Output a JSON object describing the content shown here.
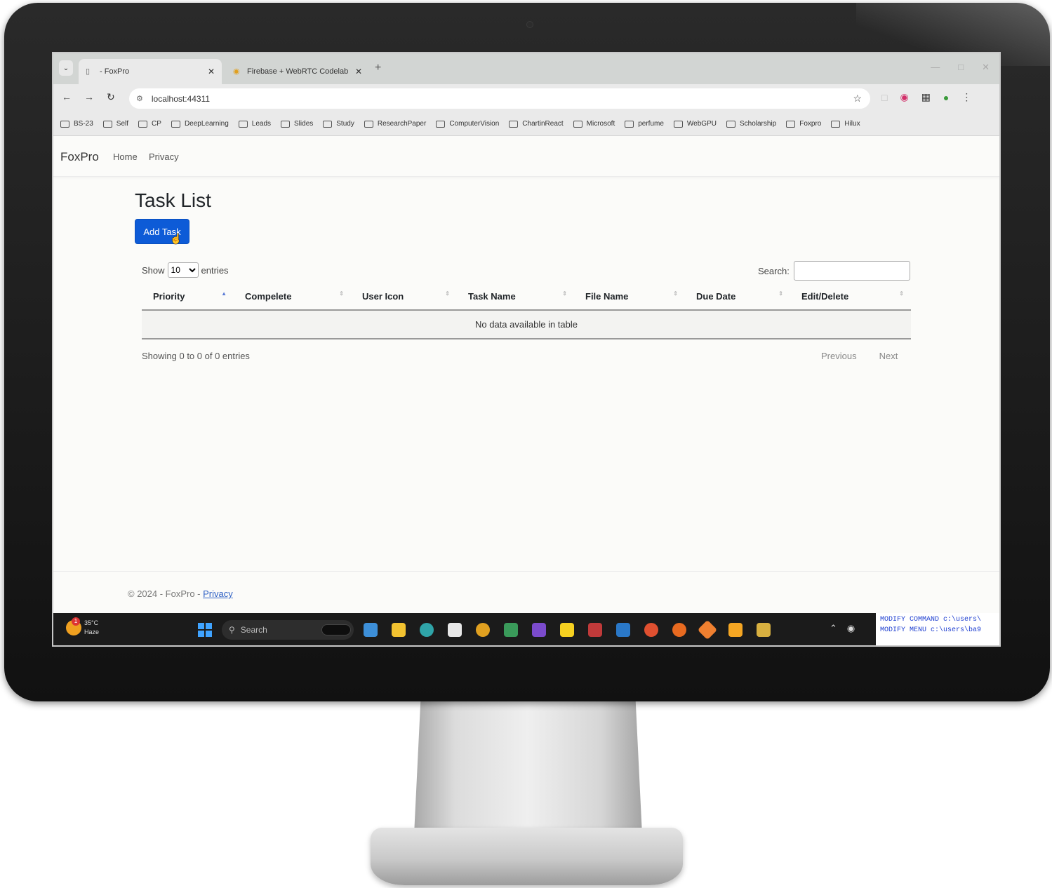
{
  "browser": {
    "tabs": [
      {
        "title": "- FoxPro",
        "active": true
      },
      {
        "title": "Firebase + WebRTC Codelab",
        "active": false
      }
    ],
    "url": "localhost:44311",
    "bookmarks": [
      "BS-23",
      "Self",
      "CP",
      "DeepLearning",
      "Leads",
      "Slides",
      "Study",
      "ResearchPaper",
      "ComputerVision",
      "ChartinReact",
      "Microsoft",
      "perfume",
      "WebGPU",
      "Scholarship",
      "Foxpro",
      "Hilux"
    ]
  },
  "navbar": {
    "brand": "FoxPro",
    "links": [
      "Home",
      "Privacy"
    ]
  },
  "page": {
    "title": "Task List",
    "add_button": "Add Task"
  },
  "table_controls": {
    "show_label": "Show",
    "length_value": "10",
    "entries_label": "entries",
    "search_label": "Search:"
  },
  "table": {
    "columns": [
      "Priority",
      "Compelete",
      "User Icon",
      "Task Name",
      "File Name",
      "Due Date",
      "Edit/Delete"
    ],
    "empty_message": "No data available in table"
  },
  "table_footer": {
    "info": "Showing 0 to 0 of 0 entries",
    "previous": "Previous",
    "next": "Next"
  },
  "footer": {
    "copyright": "© 2024 - FoxPro - ",
    "privacy_link": "Privacy"
  },
  "taskbar": {
    "weather_temp": "35°C",
    "weather_desc": "Haze",
    "search_placeholder": "Search"
  },
  "console": {
    "line1": "MODIFY COMMAND c:\\users\\",
    "line2": "MODIFY MENU c:\\users\\ba9"
  },
  "colors": {
    "primary_button": "#0d5bd7",
    "link": "#2d5fc4",
    "taskbar": "#1b1b1b",
    "console_text": "#1e3fd0"
  }
}
